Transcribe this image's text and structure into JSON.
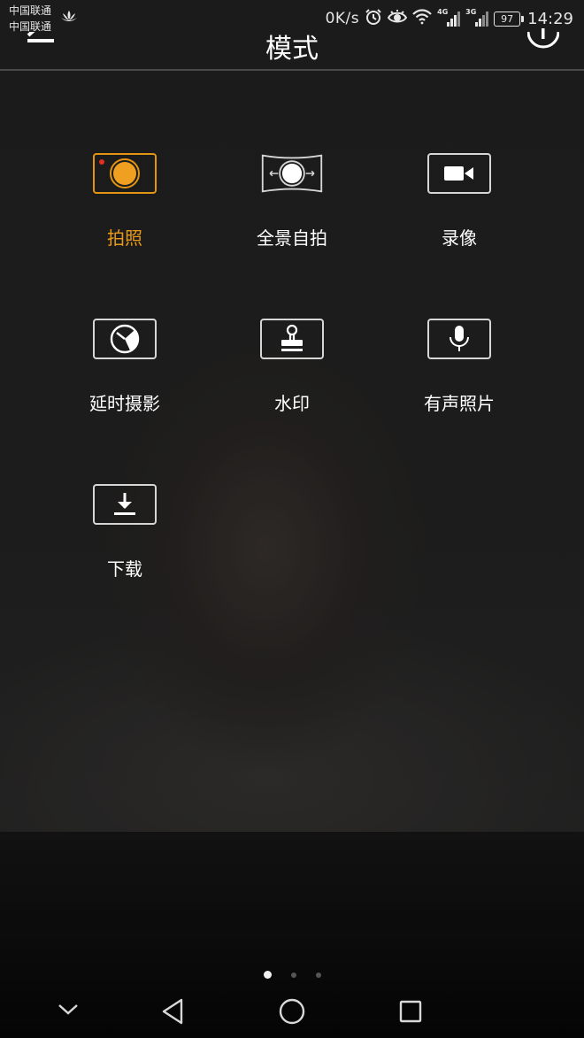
{
  "status_bar": {
    "carrier_1": "中国联通",
    "carrier_2": "中国联通",
    "net_speed": "0K/s",
    "signal_1_label": "4G",
    "signal_2_label": "3G",
    "battery_level": "97",
    "time": "14:29",
    "icons": [
      "lotus-icon",
      "alarm-icon",
      "eye-icon",
      "wifi-icon",
      "signal-icon",
      "battery-icon"
    ]
  },
  "header": {
    "title": "模式",
    "left_icon": "edit-icon",
    "right_icon": "info-icon"
  },
  "modes": [
    {
      "label": "拍照",
      "icon": "photo-icon",
      "active": true
    },
    {
      "label": "全景自拍",
      "icon": "panorama-icon",
      "active": false
    },
    {
      "label": "录像",
      "icon": "video-icon",
      "active": false
    },
    {
      "label": "延时摄影",
      "icon": "timelapse-icon",
      "active": false
    },
    {
      "label": "水印",
      "icon": "watermark-icon",
      "active": false
    },
    {
      "label": "有声照片",
      "icon": "microphone-icon",
      "active": false
    },
    {
      "label": "下载",
      "icon": "download-icon",
      "active": false
    }
  ],
  "pager": {
    "total": 3,
    "current": 1
  },
  "navigation": {
    "buttons": [
      "chevron-down-icon",
      "back-icon",
      "home-icon",
      "recents-icon"
    ]
  },
  "colors": {
    "accent": "#e99a1a",
    "icon_border": "#d6d6d6",
    "record_dot": "#e03020"
  }
}
